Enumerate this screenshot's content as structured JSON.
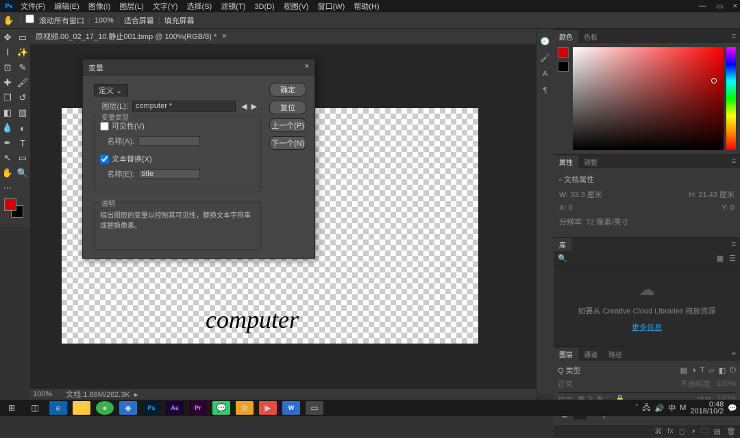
{
  "menu": {
    "items": [
      "文件(F)",
      "编辑(E)",
      "图像(I)",
      "图层(L)",
      "文字(Y)",
      "选择(S)",
      "滤镜(T)",
      "3D(D)",
      "视图(V)",
      "窗口(W)",
      "帮助(H)"
    ]
  },
  "option_bar": {
    "btn1": "滚动所有窗口",
    "zoom": "100%",
    "btn2": "适合屏幕",
    "btn3": "填充屏幕"
  },
  "doc_tab": {
    "title": "原视频.00_02_17_10.静止001.bmp @ 100%(RGB/8) *",
    "close": "×"
  },
  "dialog": {
    "title": "变量",
    "section_sel": "定义",
    "layer_lbl": "图层(L):",
    "layer_val": "computer *",
    "vartype_title": "变量类型",
    "visibility": "可见性(V)",
    "name1_lbl": "名称(A):",
    "name1_val": "",
    "textrepl": "文本替换(X)",
    "name2_lbl": "名称(E):",
    "name2_val": "title",
    "desc_title": "说明",
    "desc_text": "指出图层的变量以控制其可见性，替换文本字符串或替换像素。",
    "btn_ok": "确定",
    "btn_reset": "复位",
    "btn_prev": "上一个(P)",
    "btn_next": "下一个(N)"
  },
  "canvas_text": "computer",
  "panels": {
    "color_tab1": "颜色",
    "color_tab2": "色板",
    "lib_tab": "库",
    "prop_tab1": "属性",
    "prop_tab2": "调整",
    "prop_subtitle": "文档属性",
    "prop_w_lbl": "W:",
    "prop_w": "33.3 厘米",
    "prop_h_lbl": "H:",
    "prop_h": "21.43 厘米",
    "prop_x_lbl": "X:",
    "prop_x": "0",
    "prop_y_lbl": "Y:",
    "prop_y": "0",
    "prop_res": "分辨率: 72 像素/英寸",
    "lib_text": "如要从 Creative Cloud Libraries 拖放资源",
    "lib_link": "更多信息",
    "layers_tab1": "图层",
    "layers_tab2": "通道",
    "layers_tab3": "路径",
    "layers_kind": "Q 类型",
    "layers_mode": "正常",
    "layers_opacity_lbl": "不透明度:",
    "layers_opacity": "100%",
    "layers_lock": "锁定:",
    "layers_fill_lbl": "填充:",
    "layers_fill": "100%",
    "layer1_name": "computer"
  },
  "status": {
    "zoom": "100%",
    "docsize": "文档:1.86M/262.3K"
  },
  "tray": {
    "time": "0:48",
    "date": "2018/10/2"
  }
}
